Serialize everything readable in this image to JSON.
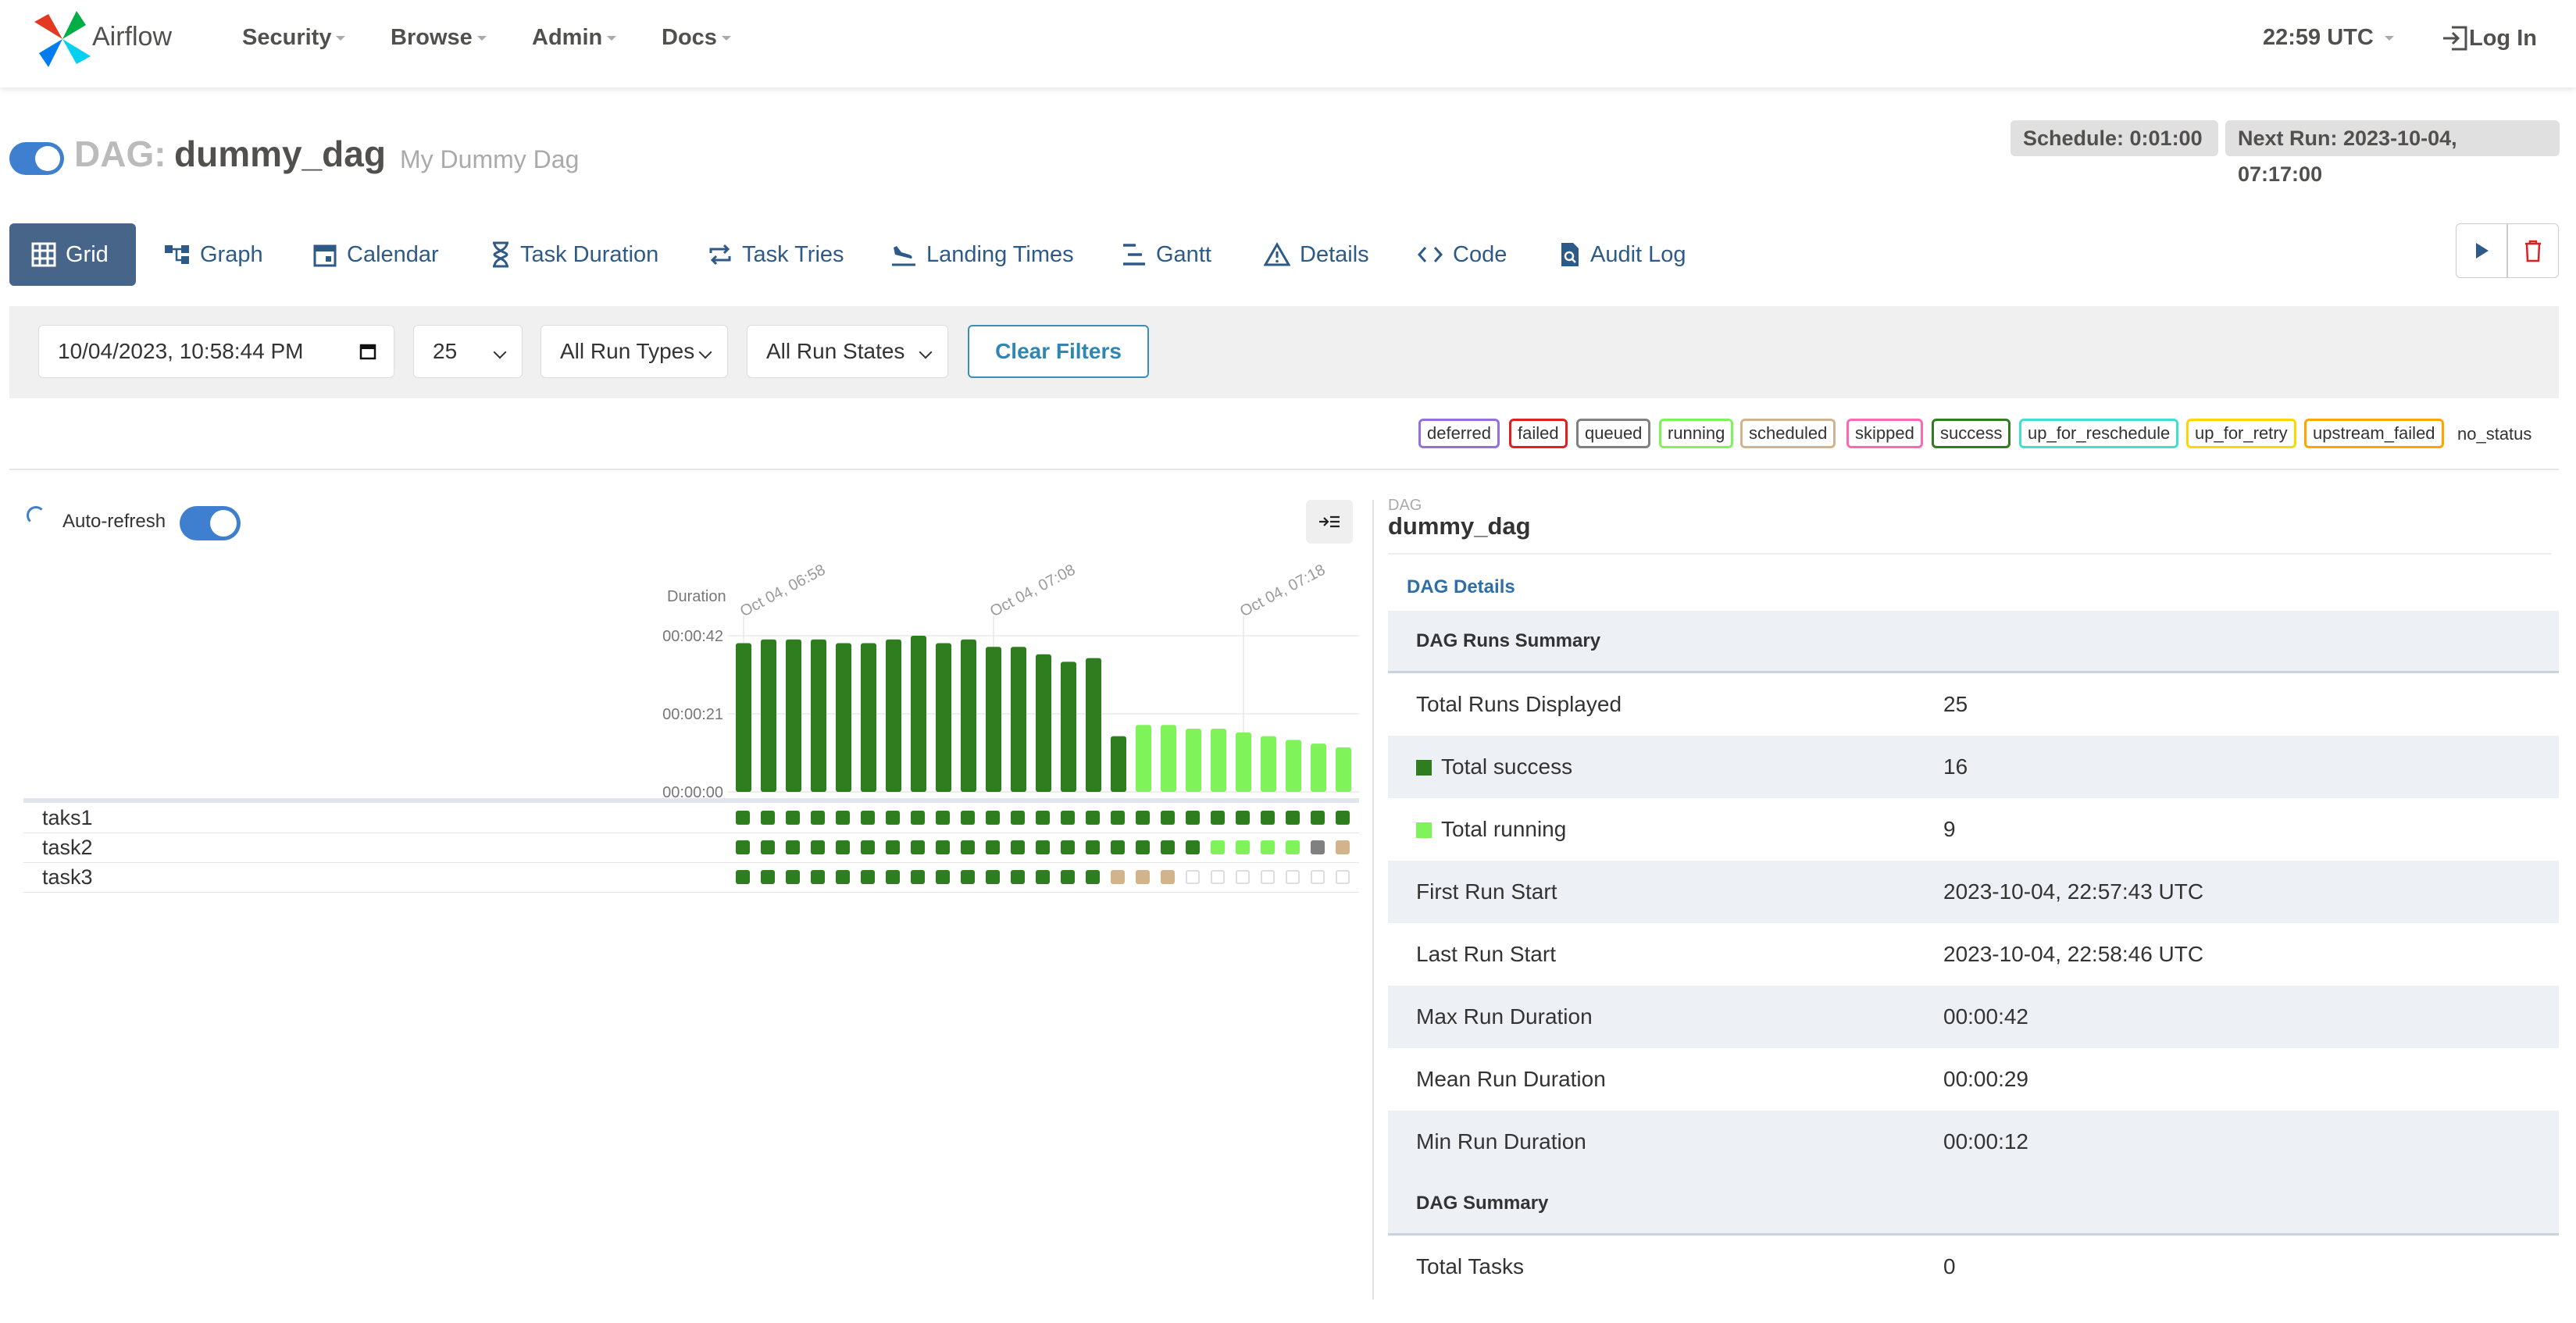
{
  "navbar": {
    "brand": "Airflow",
    "menu": [
      "Security",
      "Browse",
      "Admin",
      "Docs"
    ],
    "time": "22:59 UTC",
    "login": "Log In"
  },
  "dag": {
    "label": "DAG:",
    "id": "dummy_dag",
    "description": "My Dummy Dag",
    "schedule": "Schedule: 0:01:00",
    "next_run": "Next Run: 2023-10-04, 07:17:00"
  },
  "tabs": [
    {
      "label": "Grid",
      "icon": "grid-icon"
    },
    {
      "label": "Graph",
      "icon": "graph-icon"
    },
    {
      "label": "Calendar",
      "icon": "calendar-icon"
    },
    {
      "label": "Task Duration",
      "icon": "hourglass-icon"
    },
    {
      "label": "Task Tries",
      "icon": "repeat-icon"
    },
    {
      "label": "Landing Times",
      "icon": "landing-icon"
    },
    {
      "label": "Gantt",
      "icon": "gantt-icon"
    },
    {
      "label": "Details",
      "icon": "warning-icon"
    },
    {
      "label": "Code",
      "icon": "code-icon"
    },
    {
      "label": "Audit Log",
      "icon": "audit-icon"
    }
  ],
  "filters": {
    "date": "10/04/2023, 10:58:44 PM",
    "count": "25",
    "run_types": "All Run Types",
    "run_states": "All Run States",
    "clear": "Clear Filters"
  },
  "legend": [
    {
      "label": "deferred",
      "color": "#9370db"
    },
    {
      "label": "failed",
      "color": "#e02020"
    },
    {
      "label": "queued",
      "color": "#808080"
    },
    {
      "label": "running",
      "color": "#7ff45a"
    },
    {
      "label": "scheduled",
      "color": "#d2b48c"
    },
    {
      "label": "skipped",
      "color": "#ff69b4"
    },
    {
      "label": "success",
      "color": "#2e7d1e"
    },
    {
      "label": "up_for_reschedule",
      "color": "#40e0d0"
    },
    {
      "label": "up_for_retry",
      "color": "#ffd700"
    },
    {
      "label": "upstream_failed",
      "color": "#ffa500"
    },
    {
      "label": "no_status",
      "color": null
    }
  ],
  "grid": {
    "auto_refresh": "Auto-refresh",
    "tasks": [
      {
        "name": "taks1",
        "states": [
          "success",
          "success",
          "success",
          "success",
          "success",
          "success",
          "success",
          "success",
          "success",
          "success",
          "success",
          "success",
          "success",
          "success",
          "success",
          "success",
          "success",
          "success",
          "success",
          "success",
          "success",
          "success",
          "success",
          "success",
          "success"
        ]
      },
      {
        "name": "task2",
        "states": [
          "success",
          "success",
          "success",
          "success",
          "success",
          "success",
          "success",
          "success",
          "success",
          "success",
          "success",
          "success",
          "success",
          "success",
          "success",
          "success",
          "success",
          "success",
          "success",
          "running",
          "running",
          "running",
          "running",
          "queued",
          "scheduled"
        ]
      },
      {
        "name": "task3",
        "states": [
          "success",
          "success",
          "success",
          "success",
          "success",
          "success",
          "success",
          "success",
          "success",
          "success",
          "success",
          "success",
          "success",
          "success",
          "success",
          "scheduled",
          "scheduled",
          "scheduled",
          "none",
          "none",
          "none",
          "none",
          "none",
          "none",
          "none"
        ]
      }
    ]
  },
  "chart_data": {
    "type": "bar",
    "ylabel": "Duration",
    "y_tick_labels": [
      "00:00:00",
      "00:00:21",
      "00:00:42"
    ],
    "ylim": [
      0,
      42
    ],
    "x_tick_labels": [
      "Oct 04, 06:58",
      "Oct 04, 07:08",
      "Oct 04, 07:18"
    ],
    "x_tick_positions": [
      0,
      10,
      20
    ],
    "values": [
      40,
      41,
      41,
      41,
      40,
      40,
      41,
      42,
      40,
      41,
      39,
      39,
      37,
      35,
      36,
      15,
      18,
      18,
      17,
      17,
      16,
      15,
      14,
      13,
      12
    ],
    "states": [
      "success",
      "success",
      "success",
      "success",
      "success",
      "success",
      "success",
      "success",
      "success",
      "success",
      "success",
      "success",
      "success",
      "success",
      "success",
      "success",
      "running",
      "running",
      "running",
      "running",
      "running",
      "running",
      "running",
      "running",
      "running"
    ],
    "colors": {
      "success": "#2e7d1e",
      "running": "#7ff45a"
    },
    "grid": true
  },
  "details": {
    "crumb_label": "DAG",
    "crumb_value": "dummy_dag",
    "link": "DAG Details",
    "rows": [
      {
        "type": "head",
        "key": "DAG Runs Summary",
        "value": ""
      },
      {
        "type": "row",
        "key": "Total Runs Displayed",
        "value": "25"
      },
      {
        "type": "row",
        "key": "Total success",
        "value": "16",
        "swatch": "#2e7d1e"
      },
      {
        "type": "row",
        "key": "Total running",
        "value": "9",
        "swatch": "#7ff45a"
      },
      {
        "type": "row",
        "key": "First Run Start",
        "value": "2023-10-04, 22:57:43 UTC"
      },
      {
        "type": "row",
        "key": "Last Run Start",
        "value": "2023-10-04, 22:58:46 UTC"
      },
      {
        "type": "row",
        "key": "Max Run Duration",
        "value": "00:00:42"
      },
      {
        "type": "row",
        "key": "Mean Run Duration",
        "value": "00:00:29"
      },
      {
        "type": "row",
        "key": "Min Run Duration",
        "value": "00:00:12"
      },
      {
        "type": "head",
        "key": "DAG Summary",
        "value": ""
      },
      {
        "type": "row",
        "key": "Total Tasks",
        "value": "0"
      }
    ]
  }
}
